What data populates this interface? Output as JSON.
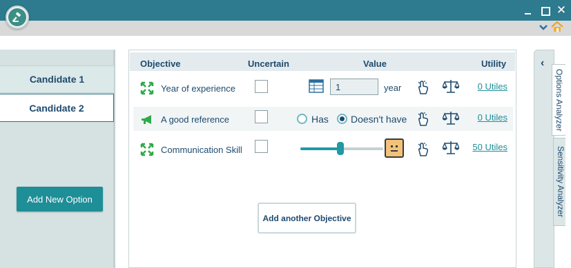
{
  "window": {
    "controls": {
      "minimize": "",
      "maximize": "",
      "close": "✕"
    }
  },
  "sidebar": {
    "candidates": [
      "Candidate 1",
      "Candidate 2"
    ],
    "selected_candidate": "Candidate 2",
    "add_option_label": "Add New Option"
  },
  "table": {
    "headers": {
      "objective": "Objective",
      "uncertain": "Uncertain",
      "value": "Value",
      "utility": "Utility"
    },
    "rows": [
      {
        "objective": "Year of experience",
        "uncertain": false,
        "value": "1",
        "unit": "year",
        "utility": "0 Utiles"
      },
      {
        "objective": "A good reference",
        "uncertain": false,
        "options": [
          "Has",
          "Doesn't have"
        ],
        "selected": "Doesn't have",
        "utility": "0 Utiles"
      },
      {
        "objective": "Communication Skill",
        "uncertain": false,
        "slider_level": 0.48,
        "utility": "50 Utiles"
      }
    ]
  },
  "add_objective_label": "Add another Objective",
  "right_rail": {
    "collapse_glyph": "‹",
    "tabs": [
      "Options Analyzer",
      "Sensitivity Analyzer"
    ]
  },
  "colors": {
    "titlebar": "#2e7a8e",
    "accent": "#1e8e97",
    "text": "#1e4a6e",
    "icon_green": "#2eaa4a"
  },
  "icons": {
    "logo": "gavel-icon",
    "expand": "expand-arrows-icon",
    "megaphone": "megaphone-icon",
    "table": "table-icon",
    "tap": "tap-hand-icon",
    "scale": "balance-scale-icon",
    "face": "neutral-face-icon",
    "home": "home-icon",
    "chevron": "chevron-down-icon"
  }
}
